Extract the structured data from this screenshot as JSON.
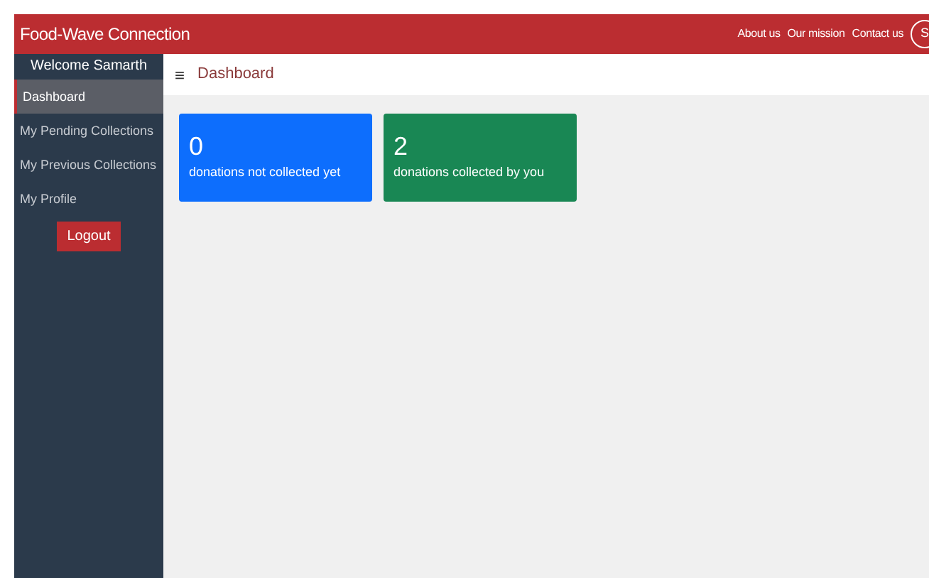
{
  "navbar": {
    "brand": "Food-Wave Connection",
    "links": [
      "About us",
      "Our mission",
      "Contact us"
    ],
    "avatar": "S"
  },
  "sidebar": {
    "welcome": "Welcome Samarth",
    "items": [
      {
        "label": "Dashboard",
        "selected": true
      },
      {
        "label": "My Pending Collections",
        "selected": false
      },
      {
        "label": "My Previous Collections",
        "selected": false
      },
      {
        "label": "My Profile",
        "selected": false
      }
    ],
    "logout": "Logout"
  },
  "header": {
    "menu_icon": "≡",
    "title": "Dashboard"
  },
  "cards": [
    {
      "value": "0",
      "label": "donations not collected yet",
      "color": "#0d6efd"
    },
    {
      "value": "2",
      "label": "donations collected by you",
      "color": "#198754"
    }
  ]
}
